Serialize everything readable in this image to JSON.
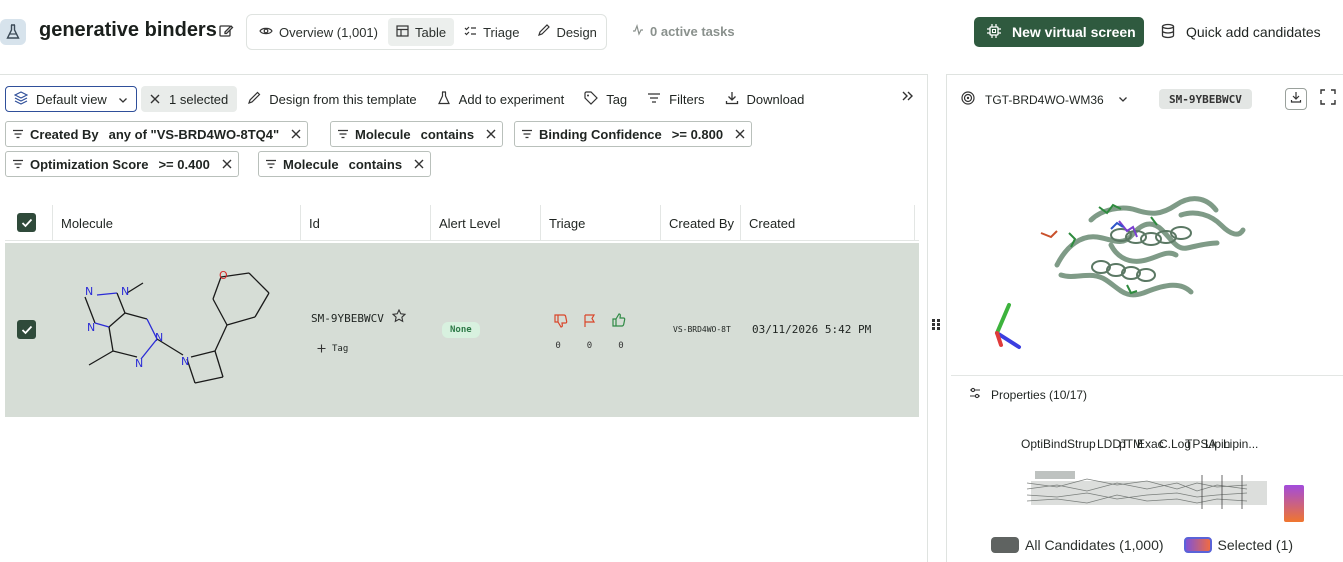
{
  "header": {
    "title": "generative binders",
    "tabs": [
      {
        "label": "Overview (1,001)",
        "icon": "eye-icon"
      },
      {
        "label": "Table",
        "icon": "table-icon",
        "active": true
      },
      {
        "label": "Triage",
        "icon": "triage-icon"
      },
      {
        "label": "Design",
        "icon": "pencil-icon"
      }
    ],
    "active_tasks": "0 active tasks",
    "new_screen_label": "New virtual screen",
    "quick_add_label": "Quick add candidates"
  },
  "toolbar": {
    "view_label": "Default view",
    "selected_label": "1 selected",
    "design_label": "Design from this template",
    "experiment_label": "Add to experiment",
    "tag_label": "Tag",
    "filters_label": "Filters",
    "download_label": "Download"
  },
  "filters": [
    {
      "field": "Created By",
      "op": "any of \"VS-BRD4WO-8TQ4\""
    },
    {
      "field": "Molecule",
      "op": "contains"
    },
    {
      "field": "Binding Confidence",
      "op": ">= 0.800"
    },
    {
      "field": "Optimization Score",
      "op": ">= 0.400"
    },
    {
      "field": "Molecule",
      "op": "contains"
    }
  ],
  "table": {
    "columns": [
      "Molecule",
      "Id",
      "Alert Level",
      "Triage",
      "Created By",
      "Created"
    ],
    "rows": [
      {
        "id": "SM-9YBEBWCV",
        "tag_label": "Tag",
        "alert": "None",
        "triage_counts": [
          "0",
          "0",
          "0"
        ],
        "created_by": "VS-BRD4WO-8T",
        "created": "03/11/2026 5:42 PM",
        "selected": true
      }
    ]
  },
  "right_panel": {
    "target": "TGT-BRD4WO-WM36",
    "molecule_badge": "SM-9YBEBWCV",
    "properties_label": "Properties (10/17)",
    "pc_labels": [
      "Opti",
      "Bind",
      "Strup",
      "LDDT",
      "pTM",
      "Exac",
      "C.Log",
      "TPSA",
      "Lipin",
      "Lipin..."
    ],
    "legend_all": "All Candidates (1,000)",
    "legend_selected": "Selected (1)"
  },
  "colors": {
    "primary": "#2f5a3f",
    "selected_row": "#d6ddd6",
    "badge_none_bg": "#d8f1df"
  }
}
